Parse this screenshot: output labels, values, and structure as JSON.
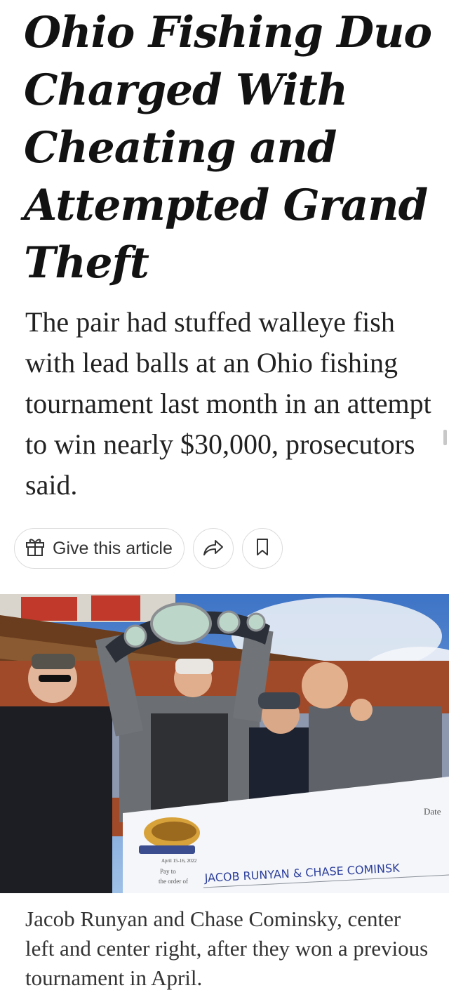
{
  "article": {
    "headline_lines": [
      "Ohio Fishing Duo",
      "Charged With",
      "Cheating and",
      "Attempted Grand",
      "Theft"
    ],
    "summary": "The pair had stuffed walleye fish with lead balls at an Ohio fishing tournament last month in an attempt to win nearly $30,000, prosecutors said.",
    "caption": "Jacob Runyan and Chase Cominsky, center left and center right, after they won a previous tournament in April."
  },
  "actions": {
    "gift_label": "Give this article",
    "gift_icon": "gift-icon",
    "share_icon": "share-arrow-icon",
    "save_icon": "bookmark-icon"
  },
  "photo": {
    "check": {
      "date_label": "Date",
      "pay_to_label": "Pay to",
      "order_of_label": "the order of",
      "payee": "JACOB RUNYAN & CHASE COMINSK",
      "event_date": "April 15-16, 2022"
    }
  },
  "colors": {
    "headline": "#121212",
    "body_text": "#222222",
    "caption_text": "#333333",
    "button_border": "#dcdcdc",
    "check_ink": "#2d3f9c"
  }
}
